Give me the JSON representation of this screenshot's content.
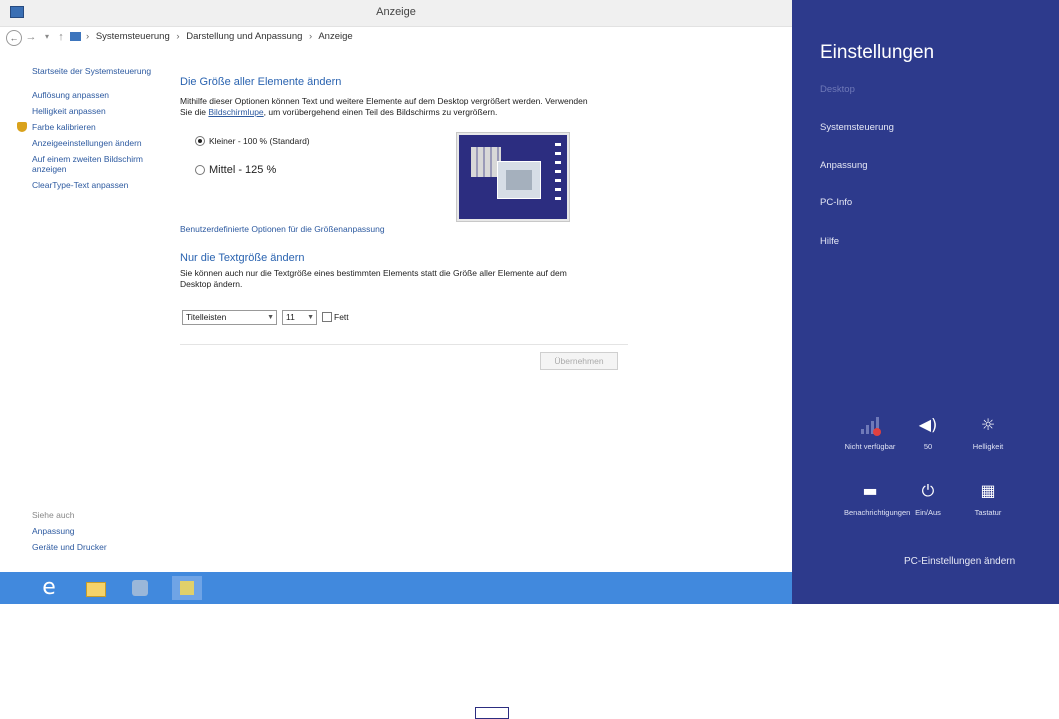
{
  "window": {
    "title": "Anzeige"
  },
  "address": {
    "crumbs": [
      "Systemsteuerung",
      "Darstellung und Anpassung",
      "Anzeige"
    ],
    "separator": "›"
  },
  "nav": {
    "back": "←",
    "forward": "→",
    "recent": "▾",
    "up": "↑"
  },
  "leftnav": {
    "home": "Startseite der Systemsteuerung",
    "items": [
      "Auflösung anpassen",
      "Helligkeit anpassen",
      "Farbe kalibrieren",
      "Anzeigeeinstellungen ändern",
      "Auf einem zweiten Bildschirm anzeigen",
      "ClearType-Text anpassen"
    ]
  },
  "seealso": {
    "heading": "Siehe auch",
    "items": [
      "Anpassung",
      "Geräte und Drucker"
    ]
  },
  "main": {
    "heading1": "Die Größe aller Elemente ändern",
    "desc_line1": "Mithilfe dieser Optionen können Text und weitere Elemente auf dem Desktop vergrößert werden. Verwenden",
    "desc_line2_pre": "Sie die",
    "desc_link": "Bildschirmlupe",
    "desc_line2_post": ", um vorübergehend einen Teil des Bildschirms zu vergrößern.",
    "radio_small": "Kleiner - 100 % (Standard)",
    "radio_medium": "Mittel - 125 %",
    "radio_selected": "small",
    "advanced_link": "Benutzerdefinierte Optionen für die Größenanpassung",
    "heading2": "Nur die Textgröße ändern",
    "desc2": "Sie können auch nur die Textgröße eines bestimmten Elements statt die Größe aller Elemente auf dem Desktop ändern.",
    "element_select": "Titelleisten",
    "size_select": "11",
    "bold_label": "Fett",
    "bold_checked": false,
    "apply": "Übernehmen"
  },
  "taskbar": {
    "ie_glyph": "e",
    "items": [
      "internet-explorer",
      "file-explorer",
      "control-panel",
      "display-settings"
    ]
  },
  "charms": {
    "title": "Einstellungen",
    "items": [
      "Desktop",
      "Systemsteuerung",
      "Anpassung",
      "PC-Info",
      "Hilfe"
    ],
    "tiles": [
      {
        "label": "Nicht verfügbar",
        "icon": "network-icon"
      },
      {
        "label": "50",
        "icon": "volume-icon",
        "glyph": "◀)"
      },
      {
        "label": "Helligkeit",
        "icon": "brightness-icon",
        "glyph": "☼"
      },
      {
        "label": "Benachrichtigungen",
        "icon": "notifications-icon",
        "glyph": "▬"
      },
      {
        "label": "Ein/Aus",
        "icon": "power-icon",
        "glyph": "⏻"
      },
      {
        "label": "Tastatur",
        "icon": "keyboard-icon",
        "glyph": "▦"
      }
    ],
    "pc_settings": "PC-Einstellungen ändern",
    "background": "#2d3a8c"
  }
}
